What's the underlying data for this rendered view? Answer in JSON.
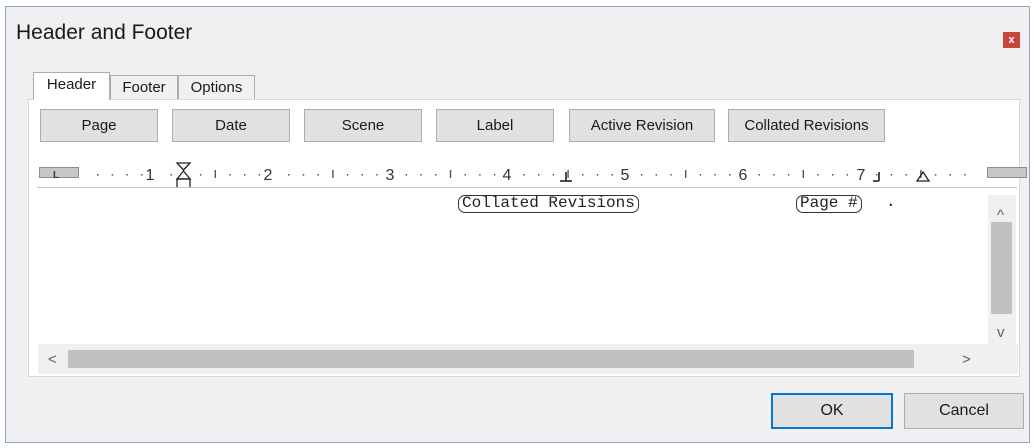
{
  "window": {
    "title": "Header and Footer",
    "close_glyph": "x"
  },
  "tabs": [
    "Header",
    "Footer",
    "Options"
  ],
  "insert_buttons": [
    "Page",
    "Date",
    "Scene",
    "Label",
    "Active Revision",
    "Collated Revisions"
  ],
  "ruler": {
    "numbers": [
      "1",
      "2",
      "3",
      "4",
      "5",
      "6",
      "7"
    ],
    "tab_stop_glyph": "L"
  },
  "editor": {
    "fields": [
      "Collated Revisions",
      "Page #"
    ],
    "trailing_text": "."
  },
  "scroll": {
    "up": "^",
    "down": "v",
    "left": "<",
    "right": ">"
  },
  "footer_buttons": {
    "ok": "OK",
    "cancel": "Cancel"
  }
}
